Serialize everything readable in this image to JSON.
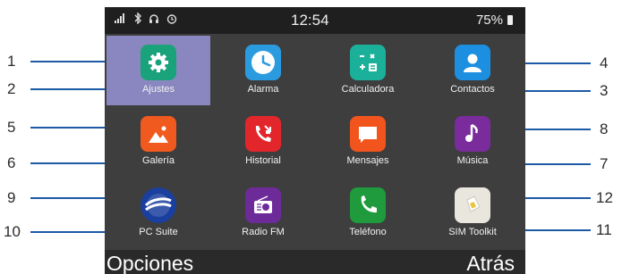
{
  "status_bar": {
    "icons": [
      "signal-icon",
      "bluetooth-icon",
      "headset-icon",
      "alarm-clock-icon"
    ],
    "time": "12:54",
    "battery": "75%"
  },
  "apps": [
    {
      "label": "Ajustes",
      "icon": "settings-gear-icon",
      "color": "#1aa37a",
      "selected": true
    },
    {
      "label": "Alarma",
      "icon": "clock-icon",
      "color": "#2b9be0"
    },
    {
      "label": "Calculadora",
      "icon": "calculator-icon",
      "color": "#1ab09a"
    },
    {
      "label": "Contactos",
      "icon": "contact-person-icon",
      "color": "#1c8fe0"
    },
    {
      "label": "Galería",
      "icon": "gallery-icon",
      "color": "#f05a1e"
    },
    {
      "label": "Historial",
      "icon": "call-history-icon",
      "color": "#e3262b"
    },
    {
      "label": "Mensajes",
      "icon": "message-icon",
      "color": "#f2541d"
    },
    {
      "label": "Música",
      "icon": "music-note-icon",
      "color": "#7a2b9c"
    },
    {
      "label": "PC Suite",
      "icon": "pc-suite-icon",
      "color": "#1a3f9e"
    },
    {
      "label": "Radio FM",
      "icon": "radio-icon",
      "color": "#6d2b9a"
    },
    {
      "label": "Teléfono",
      "icon": "phone-icon",
      "color": "#1f9a3c"
    },
    {
      "label": "SIM Toolkit",
      "icon": "sim-card-icon",
      "color": "#e9e6de"
    }
  ],
  "callouts": [
    "1",
    "2",
    "3",
    "4",
    "5",
    "6",
    "7",
    "8",
    "9",
    "10",
    "11",
    "12"
  ],
  "softkeys": {
    "left": "Opciones",
    "right": "Atrás"
  }
}
